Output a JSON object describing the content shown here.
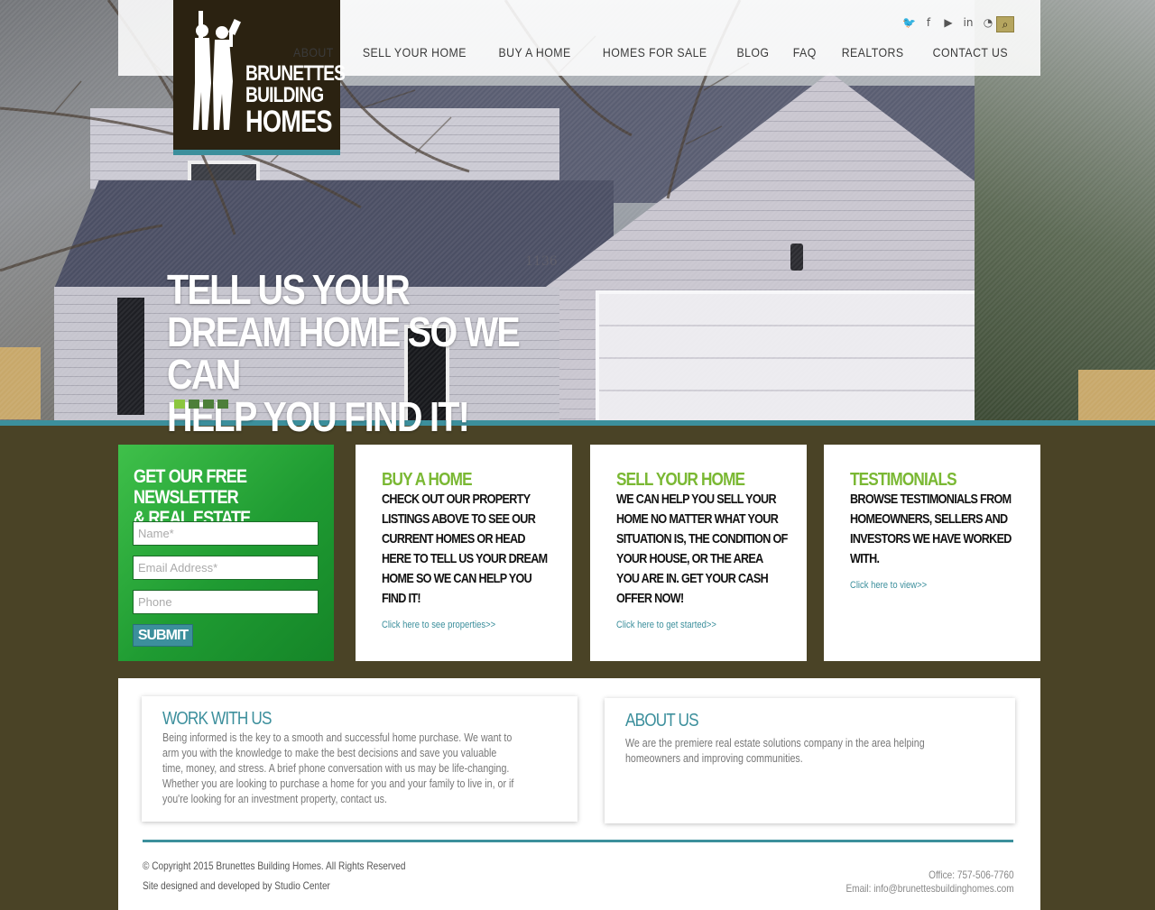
{
  "brand": {
    "line1": "BRUNETTES",
    "line2": "BUILDING",
    "line3": "HOMES",
    "logo_bg": "#2b2211",
    "accent": "#3c8f9c"
  },
  "social": [
    {
      "icon": "twitter-icon",
      "glyph": "🐦"
    },
    {
      "icon": "facebook-icon",
      "glyph": "f"
    },
    {
      "icon": "youtube-icon",
      "glyph": "▶"
    },
    {
      "icon": "linkedin-icon",
      "glyph": "in"
    },
    {
      "icon": "rss-icon",
      "glyph": "◔"
    }
  ],
  "search_icon": "search-icon",
  "nav": [
    "ABOUT",
    "SELL YOUR HOME",
    "BUY A HOME",
    "HOMES FOR SALE",
    "BLOG",
    "FAQ",
    "REALTORS",
    "CONTACT US"
  ],
  "hero": {
    "line1": "TELL US YOUR",
    "line2": "DREAM HOME SO WE CAN",
    "line3": "HELP YOU FIND IT!",
    "house_number": "1136",
    "slides": 4,
    "active_slide": 1
  },
  "newsletter": {
    "title_line1": "GET OUR FREE NEWSLETTER",
    "title_line2": "& REAL ESTATE INFORMATION",
    "name_placeholder": "Name*",
    "email_placeholder": "Email Address*",
    "phone_placeholder": "Phone",
    "submit": "SUBMIT",
    "color": "#1f9b32"
  },
  "cards": [
    {
      "title": "BUY A HOME",
      "body": "CHECK OUT OUR PROPERTY LISTINGS ABOVE TO SEE OUR CURRENT HOMES OR HEAD HERE TO TELL US YOUR DREAM HOME SO WE CAN HELP YOU FIND IT!",
      "link": "Click here to see properties>>"
    },
    {
      "title": "SELL YOUR HOME",
      "body": "WE CAN HELP YOU SELL YOUR HOME NO MATTER WHAT YOUR SITUATION IS, THE CONDITION OF YOUR HOUSE, OR THE AREA YOU ARE IN. GET YOUR CASH OFFER NOW!",
      "link": "Click here to get started>>"
    },
    {
      "title": "TESTIMONIALS",
      "body": "BROWSE TESTIMONIALS FROM HOMEOWNERS, SELLERS AND INVESTORS WE HAVE WORKED WITH.",
      "link": "Click here to view>>"
    }
  ],
  "work_with_us": {
    "title": "WORK WITH US",
    "body": "Being informed is the key to a smooth and successful home purchase. We want to arm you with the knowledge to make the best decisions and save you valuable time, money, and stress. A brief phone conversation with us may be life-changing. Whether you are looking to purchase a home for you and your family to live in, or if you're looking for an investment property, contact us."
  },
  "about_us": {
    "title": "ABOUT US",
    "body": "We are the premiere real estate solutions company in the area helping homeowners and improving communities."
  },
  "footer": {
    "copyright": "© Copyright 2015 Brunettes Building Homes. All Rights Reserved",
    "credit": "Site designed and developed by Studio Center",
    "office": "Office: 757-506-7760",
    "email": "Email: info@brunettesbuildinghomes.com"
  }
}
